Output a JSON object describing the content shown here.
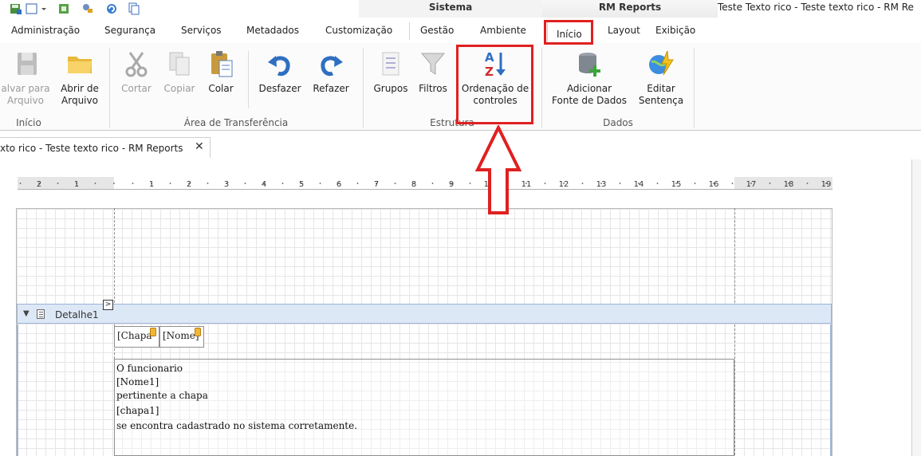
{
  "window": {
    "context_tabs": [
      "Sistema",
      "RM Reports"
    ],
    "title": "Teste Texto rico - Teste texto rico - RM Re"
  },
  "quick_access": [
    "save-icon",
    "new-icon",
    "dropdown-icon",
    "window-icon",
    "tools-icon",
    "refresh-icon",
    "copy-icon"
  ],
  "tabs": [
    "Administração",
    "Segurança",
    "Serviços",
    "Metadados",
    "Customização",
    "Gestão",
    "Ambiente",
    "Início",
    "Layout",
    "Exibição"
  ],
  "active_tab": "Início",
  "ribbon": {
    "inicio_group": {
      "label": "Início",
      "salvar": {
        "line1": "alvar para",
        "line2": "Arquivo"
      },
      "abrir": {
        "line1": "Abrir de",
        "line2": "Arquivo"
      }
    },
    "transfer_group": {
      "label": "Área de Transferência",
      "cortar": "Cortar",
      "copiar": "Copiar",
      "colar": "Colar",
      "desfazer": "Desfazer",
      "refazer": "Refazer"
    },
    "estrutura_group": {
      "label": "Estrutura",
      "grupos": "Grupos",
      "filtros": "Filtros",
      "ordenacao": {
        "line1": "Ordenação de",
        "line2": "controles"
      }
    },
    "dados_group": {
      "label": "Dados",
      "adicionar": {
        "line1": "Adicionar",
        "line2": "Fonte de Dados"
      },
      "editar": {
        "line1": "Editar",
        "line2": "Sentença"
      }
    }
  },
  "document_tab": {
    "title": "xto rico - Teste texto rico - RM Reports",
    "close": "✕"
  },
  "ruler": {
    "labels": [
      "2",
      "1",
      "1",
      "2",
      "3",
      "4",
      "5",
      "6",
      "7",
      "8",
      "9",
      "10",
      "11",
      "12",
      "13",
      "14",
      "15",
      "16",
      "17",
      "18",
      "19"
    ]
  },
  "designer": {
    "band_label": "Detalhe1",
    "band_toggle": "▼",
    "smart_tag": ">",
    "fields": [
      "[Chapa",
      "[Nome]"
    ],
    "rich_text_lines": [
      "O funcionario",
      "[Nome1]",
      "pertinente a chapa",
      "[chapa1]",
      "se encontra cadastrado no sistema corretamente."
    ]
  },
  "colors": {
    "annotation_red": "#e02020",
    "band_blue": "#dde8f6"
  }
}
